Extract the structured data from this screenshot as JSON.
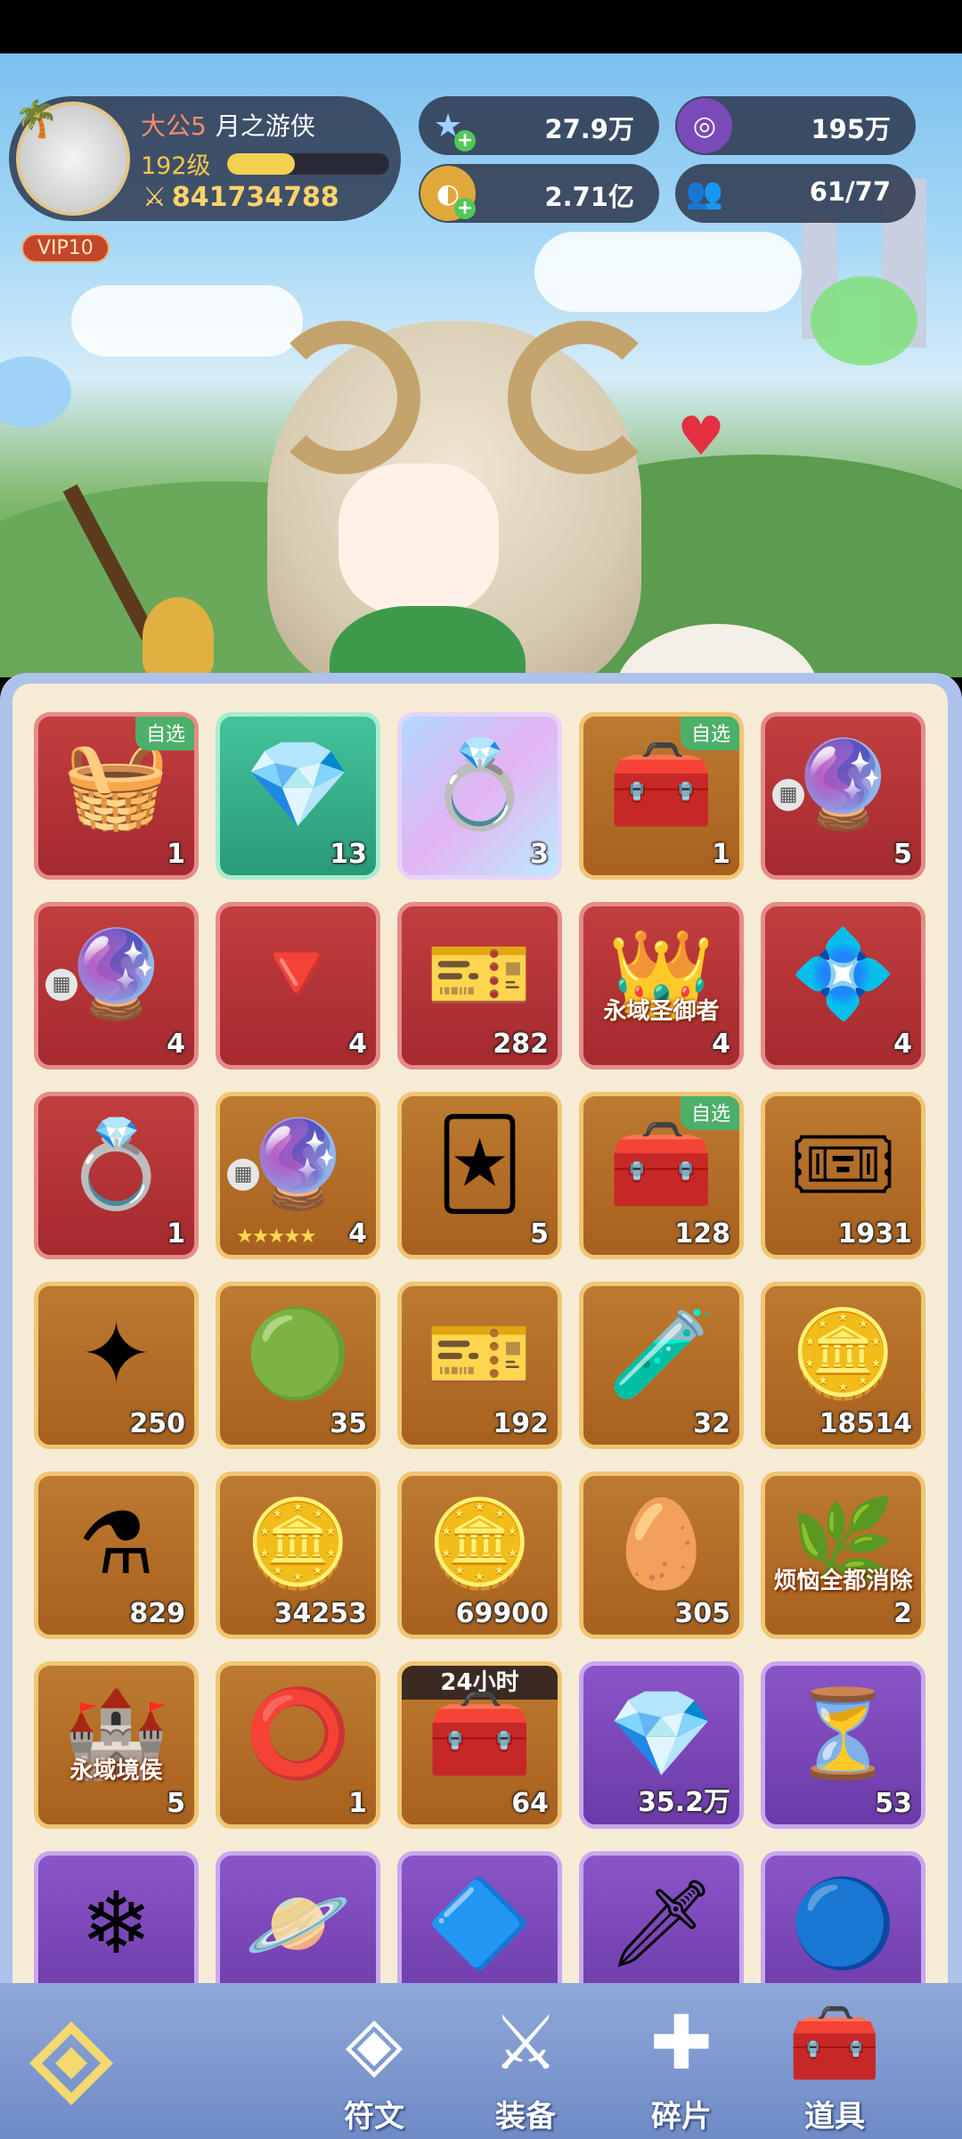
{
  "profile": {
    "title": "大公5",
    "name": "月之游侠",
    "level": "192级",
    "xp_fraction": 0.42,
    "power": "841734788",
    "vip": "VIP10"
  },
  "resources": {
    "star_gem": "27.9万",
    "purple_coin": "195万",
    "gold_coin": "2.71亿",
    "party": "61/77"
  },
  "items": [
    {
      "style": "red",
      "icon": "fruit-basket-icon",
      "glyph": "🧺",
      "badge": "自选",
      "count": "1"
    },
    {
      "style": "green",
      "icon": "rainbow-crystal-icon",
      "glyph": "💎",
      "count": "13"
    },
    {
      "style": "rainbow",
      "icon": "feather-ring-icon",
      "glyph": "💍",
      "count": "3"
    },
    {
      "style": "gold",
      "icon": "treasure-chest-icon",
      "glyph": "🧰",
      "badge": "自选",
      "count": "1"
    },
    {
      "style": "red",
      "icon": "red-orb-moon-icon",
      "glyph": "🔮",
      "count": "5",
      "gridmark": true
    },
    {
      "style": "red",
      "icon": "red-orb-triple-moon-icon",
      "glyph": "🔮",
      "count": "4",
      "gridmark": true
    },
    {
      "style": "red",
      "icon": "red-crystal-icon",
      "glyph": "🔻",
      "count": "4"
    },
    {
      "style": "red",
      "icon": "golden-ticket-icon",
      "glyph": "🎫",
      "count": "282"
    },
    {
      "style": "red",
      "icon": "crown-banner-icon",
      "glyph": "👑",
      "label": "永域圣御者",
      "count": "4"
    },
    {
      "style": "red",
      "icon": "silver-ring-icon",
      "glyph": "💠",
      "count": "4"
    },
    {
      "style": "red",
      "icon": "lion-feather-ring-icon",
      "glyph": "💍",
      "count": "1"
    },
    {
      "style": "gold",
      "icon": "golden-orb-icon",
      "glyph": "🔮",
      "count": "4",
      "gridmark": true,
      "stars": "★★★★★"
    },
    {
      "style": "gold",
      "icon": "golden-card-icon",
      "glyph": "🃏",
      "count": "5"
    },
    {
      "style": "gold",
      "icon": "treasure-chest-open-icon",
      "glyph": "🧰",
      "badge": "自选",
      "count": "128"
    },
    {
      "style": "gold",
      "icon": "wheel-ticket-icon",
      "glyph": "🎟",
      "count": "1931"
    },
    {
      "style": "gold",
      "icon": "ice-star-icon",
      "glyph": "✦",
      "count": "250"
    },
    {
      "style": "gold",
      "icon": "green-crystal-icon",
      "glyph": "🟢",
      "count": "35"
    },
    {
      "style": "gold",
      "icon": "heart-ticket-icon",
      "glyph": "🎫",
      "count": "192"
    },
    {
      "style": "gold",
      "icon": "rainbow-potion-icon",
      "glyph": "🧪",
      "count": "32"
    },
    {
      "style": "gold",
      "icon": "silver-lock-coin-icon",
      "glyph": "🪙",
      "count": "18514"
    },
    {
      "style": "gold",
      "icon": "lightning-potion-icon",
      "glyph": "⚗",
      "count": "829"
    },
    {
      "style": "gold",
      "icon": "bronze-coin-icon",
      "glyph": "🪙",
      "count": "34253"
    },
    {
      "style": "gold",
      "icon": "purple-coin-icon",
      "glyph": "🪙",
      "count": "69900"
    },
    {
      "style": "gold",
      "icon": "dragon-egg-icon",
      "glyph": "🥚",
      "count": "305"
    },
    {
      "style": "gold",
      "icon": "garden-badge-icon",
      "glyph": "🌿",
      "label": "烦恼全都消除",
      "count": "2"
    },
    {
      "style": "gold",
      "icon": "castle-banner-icon",
      "glyph": "🏰",
      "label": "永域境侯",
      "count": "5"
    },
    {
      "style": "gold",
      "icon": "gold-ring-icon",
      "glyph": "⭕",
      "count": "1"
    },
    {
      "style": "gold",
      "icon": "gold-chest-timed-icon",
      "glyph": "🧰",
      "toplabel": "24小时",
      "count": "64"
    },
    {
      "style": "purple",
      "icon": "diamond-crystal-icon",
      "glyph": "💎",
      "count": "35.2万"
    },
    {
      "style": "purple",
      "icon": "hourglass-icon",
      "glyph": "⏳",
      "count": "53"
    },
    {
      "style": "purple",
      "icon": "ice-crystals-icon",
      "glyph": "❄",
      "count": ""
    },
    {
      "style": "purple",
      "icon": "purple-orbit-icon",
      "glyph": "🪐",
      "count": ""
    },
    {
      "style": "purple",
      "icon": "violet-gem-icon",
      "glyph": "🔷",
      "count": ""
    },
    {
      "style": "purple",
      "icon": "sword-card-icon",
      "glyph": "🗡",
      "count": ""
    },
    {
      "style": "purple",
      "icon": "blue-planet-orb-icon",
      "glyph": "🔵",
      "count": ""
    }
  ],
  "nav": [
    {
      "label": "符文",
      "icon": "rune-icon",
      "glyph": "◈"
    },
    {
      "label": "装备",
      "icon": "crossed-swords-icon",
      "glyph": "⚔"
    },
    {
      "label": "碎片",
      "icon": "puzzle-piece-icon",
      "glyph": "✚"
    },
    {
      "label": "道具",
      "icon": "treasure-chest-icon",
      "glyph": "🧰"
    }
  ]
}
